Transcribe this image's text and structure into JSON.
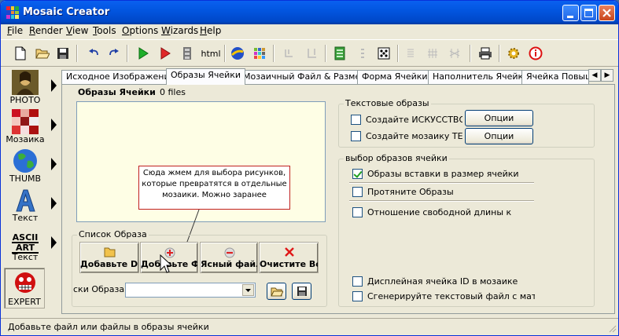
{
  "window": {
    "title": "Mosaic Creator"
  },
  "menu": [
    "File",
    "Render",
    "View",
    "Tools",
    "Options",
    "Wizards",
    "Help"
  ],
  "toolbar": {
    "html_label": "html"
  },
  "sidebar": [
    {
      "label": "PHOTO",
      "icon": "mona-lisa-icon"
    },
    {
      "label": "Мозаика",
      "icon": "mosaic-grid-icon"
    },
    {
      "label": "THUMB",
      "icon": "globe-icon"
    },
    {
      "label": "Текст",
      "icon": "letter-a-icon"
    },
    {
      "label": "Текст",
      "icon": "ascii-art-icon",
      "badge_top": "ASCII",
      "badge_bottom": "ART"
    },
    {
      "label": "EXPERT",
      "icon": "expert-face-icon"
    }
  ],
  "tabs": [
    "Исходное Изображение",
    "Образы Ячейки",
    "Мозаичный Файл & Размер",
    "Форма Ячейки",
    "Наполнитель Ячейки",
    "Ячейка Повыш"
  ],
  "active_tab": "Образы Ячейки",
  "cell_images": {
    "title": "Образы Ячейки",
    "count_text": "0 files"
  },
  "callout": "Сюда жмем для выбора рисунков, которые превратятся в отдельные мозаики. Можно заранее",
  "image_list": {
    "legend": "Список Образа",
    "buttons": {
      "add": "Добавьте Dir",
      "add_file": "Добавьте Файл",
      "clear_file": "Ясный файл",
      "clear_all": "Очистите Все"
    },
    "path_label": "ски Образа"
  },
  "text_images": {
    "legend": "Текстовые образы",
    "create_art": "Создайте ИСКУССТВО ASCII",
    "create_text_mosaic": "Создайте мозаику ТЕКСТ",
    "options": "Опции"
  },
  "cell_selection": {
    "legend": "выбор образов ячейки",
    "fit_images": "Образы вставки в размер ячейки",
    "stretch_images": "Протяните Образы",
    "free_length_ratio": "Отношение свободной длины к",
    "display_cell_id": "Дисплейная ячейка ID в мозаике",
    "gen_text_file": "Сгенерируйте текстовый файл с матрицей"
  },
  "status": "Добавьте файл или файлы в образы ячейки",
  "colors": {
    "title_bar": "#0054e3",
    "face": "#ece9d8",
    "preview": "#fefee5",
    "callout_border": "#c02020"
  }
}
